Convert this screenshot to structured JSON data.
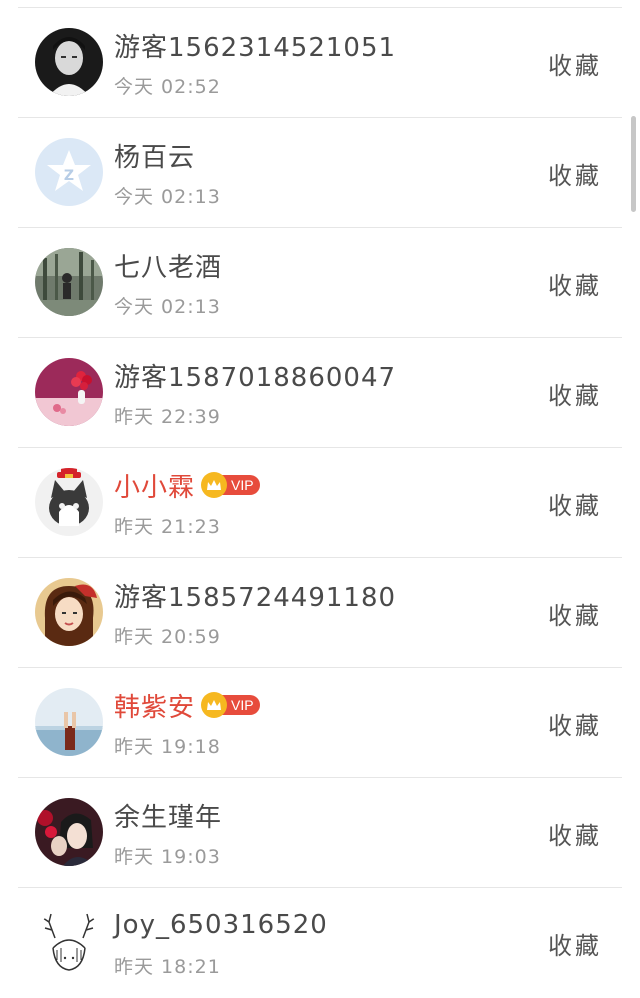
{
  "favorite_label": "收藏",
  "vip_label": "VIP",
  "accent_color": "#e0493a",
  "items": [
    {
      "name": "游客1562314521051",
      "time": "今天 02:52",
      "vip": false,
      "avatar": "photo-avatar"
    },
    {
      "name": "杨百云",
      "time": "今天 02:13",
      "vip": false,
      "avatar": "default-star-avatar"
    },
    {
      "name": "七八老酒",
      "time": "今天 02:13",
      "vip": false,
      "avatar": "photo-avatar"
    },
    {
      "name": "游客1587018860047",
      "time": "昨天 22:39",
      "vip": false,
      "avatar": "flower-avatar"
    },
    {
      "name": "小小霖",
      "time": "昨天 21:23",
      "vip": true,
      "avatar": "cat-avatar"
    },
    {
      "name": "游客1585724491180",
      "time": "昨天 20:59",
      "vip": false,
      "avatar": "photo-avatar"
    },
    {
      "name": "韩紫安",
      "time": "昨天 19:18",
      "vip": true,
      "avatar": "beach-avatar"
    },
    {
      "name": "余生瑾年",
      "time": "昨天 19:03",
      "vip": false,
      "avatar": "photo-avatar"
    },
    {
      "name": "Joy_650316520",
      "time": "昨天 18:21",
      "vip": false,
      "avatar": "sketch-avatar"
    }
  ]
}
